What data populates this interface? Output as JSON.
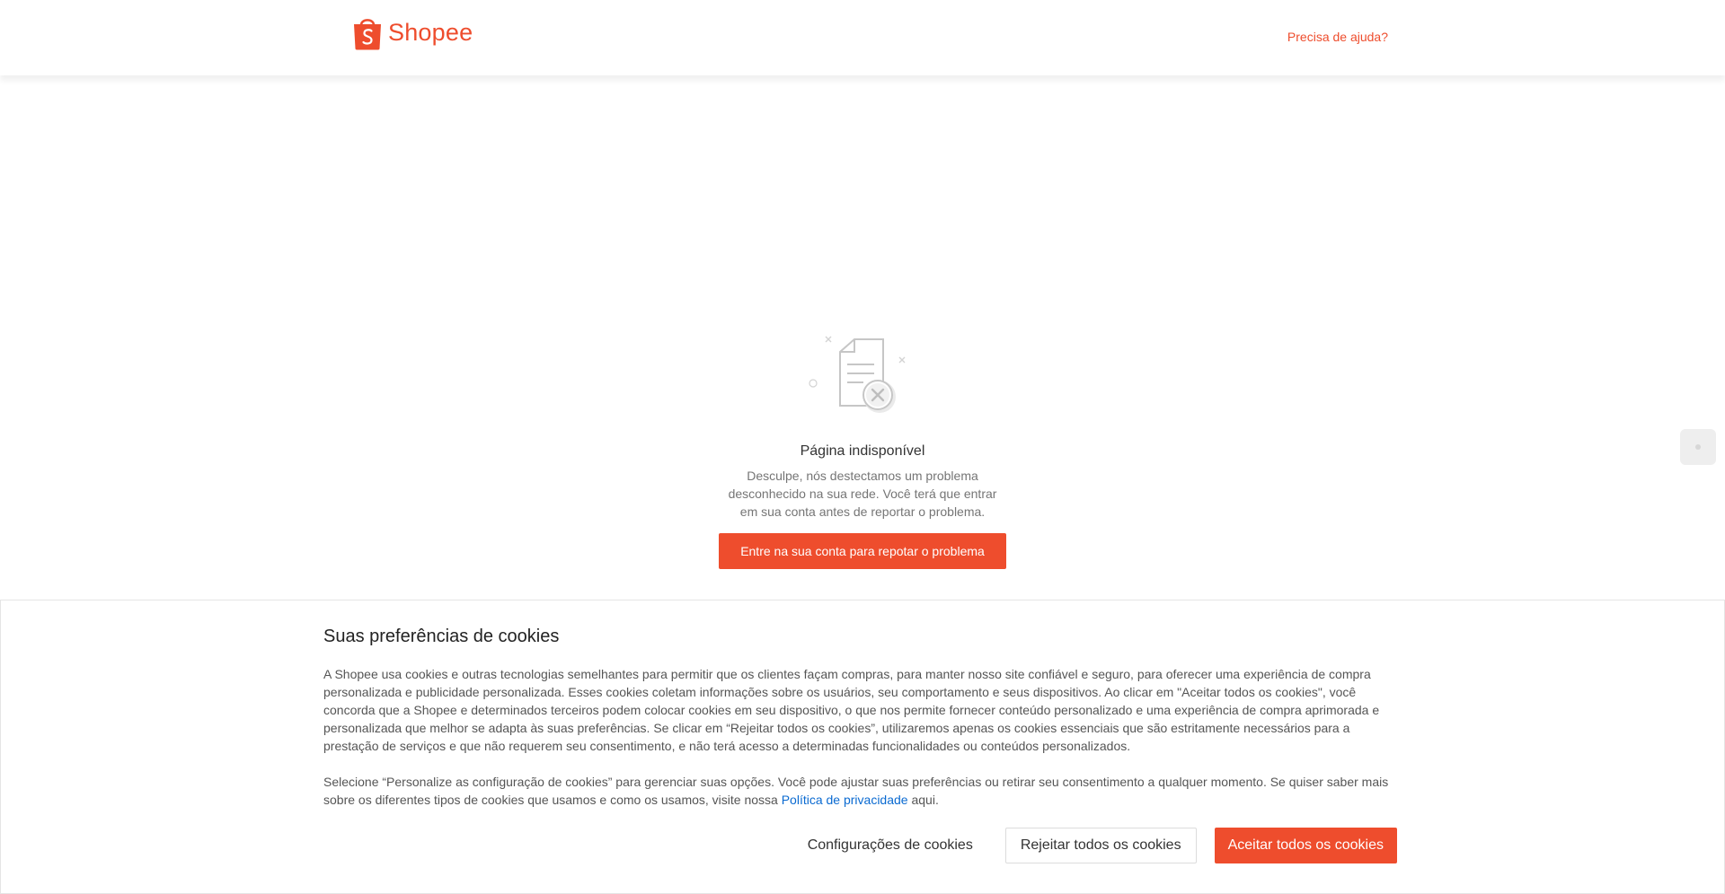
{
  "header": {
    "logo_text": "Shopee",
    "help_link": "Precisa de ajuda?"
  },
  "error": {
    "title": "Página indisponível",
    "description": "Desculpe, nós destectamos um problema desconhecido na sua rede. Você terá que entrar em sua conta antes de reportar o problema.",
    "button_label": "Entre na sua conta para repotar o problema"
  },
  "cookies": {
    "title": "Suas preferências de cookies",
    "paragraph1": "A Shopee usa cookies e outras tecnologias semelhantes para permitir que os clientes façam compras, para manter nosso site confiável e seguro, para oferecer uma experiência de compra personalizada e publicidade personalizada. Esses cookies coletam informações sobre os usuários, seu comportamento e seus dispositivos. Ao clicar em \"Aceitar todos os cookies\", você concorda que a Shopee e determinados terceiros podem colocar cookies em seu dispositivo, o que nos permite fornecer conteúdo personalizado e uma experiência de compra aprimorada e personalizada que melhor se adapta às suas preferências. Se clicar em “Rejeitar todos os cookies”, utilizaremos apenas os cookies essenciais que são estritamente necessários para a prestação de serviços e que não requerem seu consentimento, e não terá acesso a determinadas funcionalidades ou conteúdos personalizados.",
    "paragraph2_before": "Selecione “Personalize as configuração de cookies” para gerenciar suas opções. Você pode ajustar suas preferências ou retirar seu consentimento a qualquer momento. Se quiser saber mais sobre os diferentes tipos de cookies que usamos e como os usamos, visite nossa ",
    "privacy_link": "Política de privacidade",
    "paragraph2_after": " aqui.",
    "settings_button": "Configurações de cookies",
    "reject_button": "Rejeitar todos os cookies",
    "accept_button": "Aceitar todos os cookies"
  },
  "colors": {
    "brand": "#ee4d2d",
    "link": "#0a6ad1"
  },
  "icons": {
    "logo": "shopee-bag-icon",
    "error": "document-error-icon"
  }
}
